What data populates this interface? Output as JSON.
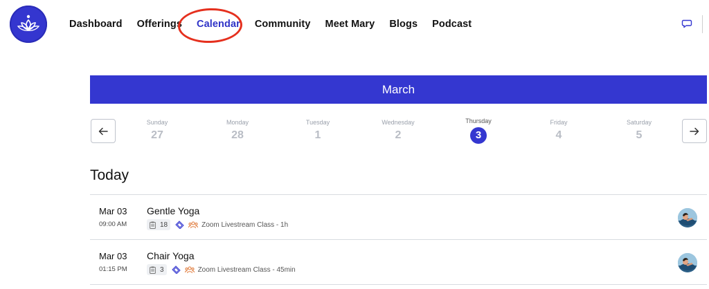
{
  "nav": {
    "items": [
      {
        "label": "Dashboard"
      },
      {
        "label": "Offerings"
      },
      {
        "label": "Calendar"
      },
      {
        "label": "Community"
      },
      {
        "label": "Meet Mary"
      },
      {
        "label": "Blogs"
      },
      {
        "label": "Podcast"
      }
    ],
    "active": "Calendar"
  },
  "icons": {
    "logo": "lotus-logo-icon",
    "chat": "chat-bubble-icon",
    "prev": "arrow-left-icon",
    "next": "arrow-right-icon",
    "clipboard": "clipboard-icon",
    "ticket": "ticket-icon",
    "group": "group-icon"
  },
  "colors": {
    "accent": "#3437d0",
    "highlight_ring": "#e5301e",
    "muted_day": "#b9bdc5"
  },
  "calendar": {
    "month": "March",
    "week": [
      {
        "name": "Sunday",
        "num": "27",
        "active": false
      },
      {
        "name": "Monday",
        "num": "28",
        "active": false
      },
      {
        "name": "Tuesday",
        "num": "1",
        "active": false
      },
      {
        "name": "Wednesday",
        "num": "2",
        "active": false
      },
      {
        "name": "Thursday",
        "num": "3",
        "active": true
      },
      {
        "name": "Friday",
        "num": "4",
        "active": false
      },
      {
        "name": "Saturday",
        "num": "5",
        "active": false
      }
    ]
  },
  "today": {
    "heading": "Today",
    "events": [
      {
        "date": "Mar 03",
        "time": "09:00 AM",
        "title": "Gentle Yoga",
        "count": "18",
        "desc": "Zoom Livestream Class - 1h"
      },
      {
        "date": "Mar 03",
        "time": "01:15 PM",
        "title": "Chair Yoga",
        "count": "3",
        "desc": "Zoom Livestream Class - 45min"
      }
    ]
  }
}
